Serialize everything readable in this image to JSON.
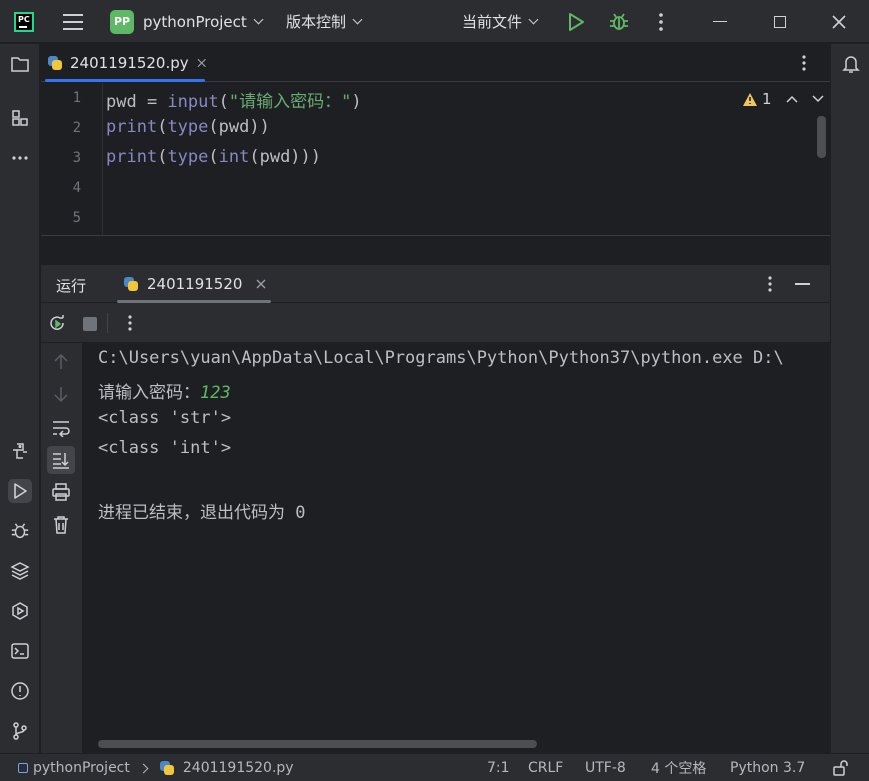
{
  "titlebar": {
    "project_badge": "PP",
    "project_name": "pythonProject",
    "vcs_label": "版本控制",
    "run_config": "当前文件"
  },
  "editor": {
    "tab_label": "2401191520.py",
    "warnings_count": "1",
    "line_numbers": [
      "1",
      "2",
      "3",
      "4",
      "5"
    ],
    "lines": [
      {
        "pre": "pwd = ",
        "fn": "input",
        "open": "(",
        "str": "\"请输入密码：\"",
        "close": ")"
      },
      {
        "fn": "print",
        "open": "(",
        "fn2": "type",
        "rest": "(pwd))"
      },
      {
        "fn": "print",
        "open": "(",
        "fn2": "type",
        "open2": "(",
        "fn3": "int",
        "rest": "(pwd)))"
      }
    ]
  },
  "run_panel": {
    "title": "运行",
    "tab_label": "2401191520"
  },
  "console": {
    "line1": "C:\\Users\\yuan\\AppData\\Local\\Programs\\Python\\Python37\\python.exe D:\\",
    "prompt": "请输入密码：",
    "input_value": "123",
    "line3": "<class 'str'>",
    "line4": "<class 'int'>",
    "exit_line": "进程已结束，退出代码为 0"
  },
  "statusbar": {
    "project": "pythonProject",
    "file": "2401191520.py",
    "position": "7:1",
    "line_sep": "CRLF",
    "encoding": "UTF-8",
    "indent": "4 个空格",
    "interpreter": "Python 3.7"
  }
}
